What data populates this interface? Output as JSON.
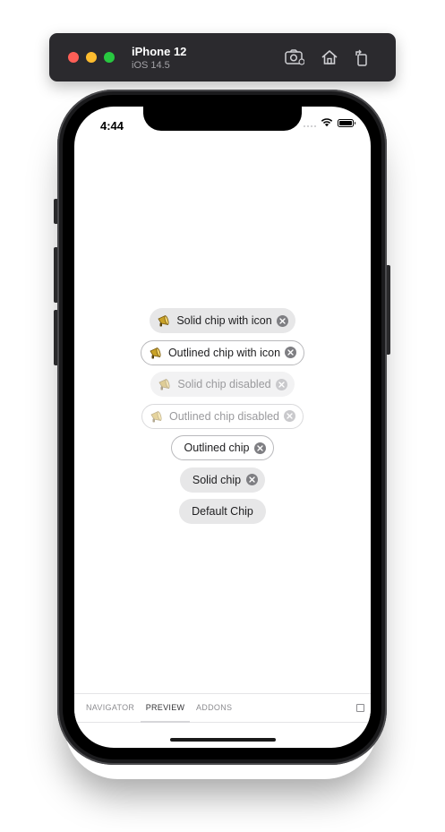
{
  "simulator": {
    "device": "iPhone 12",
    "os": "iOS 14.5",
    "icons": [
      "screenshot-icon",
      "home-icon",
      "rotate-icon"
    ]
  },
  "status_bar": {
    "time": "4:44"
  },
  "chips": [
    {
      "label": "Solid chip with icon",
      "variant": "solid",
      "icon": "megaphone-icon",
      "closable": true,
      "disabled": false
    },
    {
      "label": "Outlined chip with icon",
      "variant": "outlined",
      "icon": "megaphone-icon",
      "closable": true,
      "disabled": false
    },
    {
      "label": "Solid chip disabled",
      "variant": "solid",
      "icon": "megaphone-icon",
      "closable": true,
      "disabled": true
    },
    {
      "label": "Outlined chip disabled",
      "variant": "outlined",
      "icon": "megaphone-icon",
      "closable": true,
      "disabled": true
    },
    {
      "label": "Outlined chip",
      "variant": "outlined",
      "closable": true,
      "disabled": false
    },
    {
      "label": "Solid chip",
      "variant": "solid",
      "closable": true,
      "disabled": false
    },
    {
      "label": "Default Chip",
      "variant": "default",
      "closable": false,
      "disabled": false
    }
  ],
  "addon_panel": {
    "tabs": [
      "NAVIGATOR",
      "PREVIEW",
      "ADDONS"
    ],
    "active_tab": "PREVIEW"
  },
  "colors": {
    "chip_solid_bg": "#e7e7e8",
    "chip_outline_border": "#b9b9bc",
    "close_icon": "#7e7e82",
    "megaphone": "#c9a227"
  }
}
